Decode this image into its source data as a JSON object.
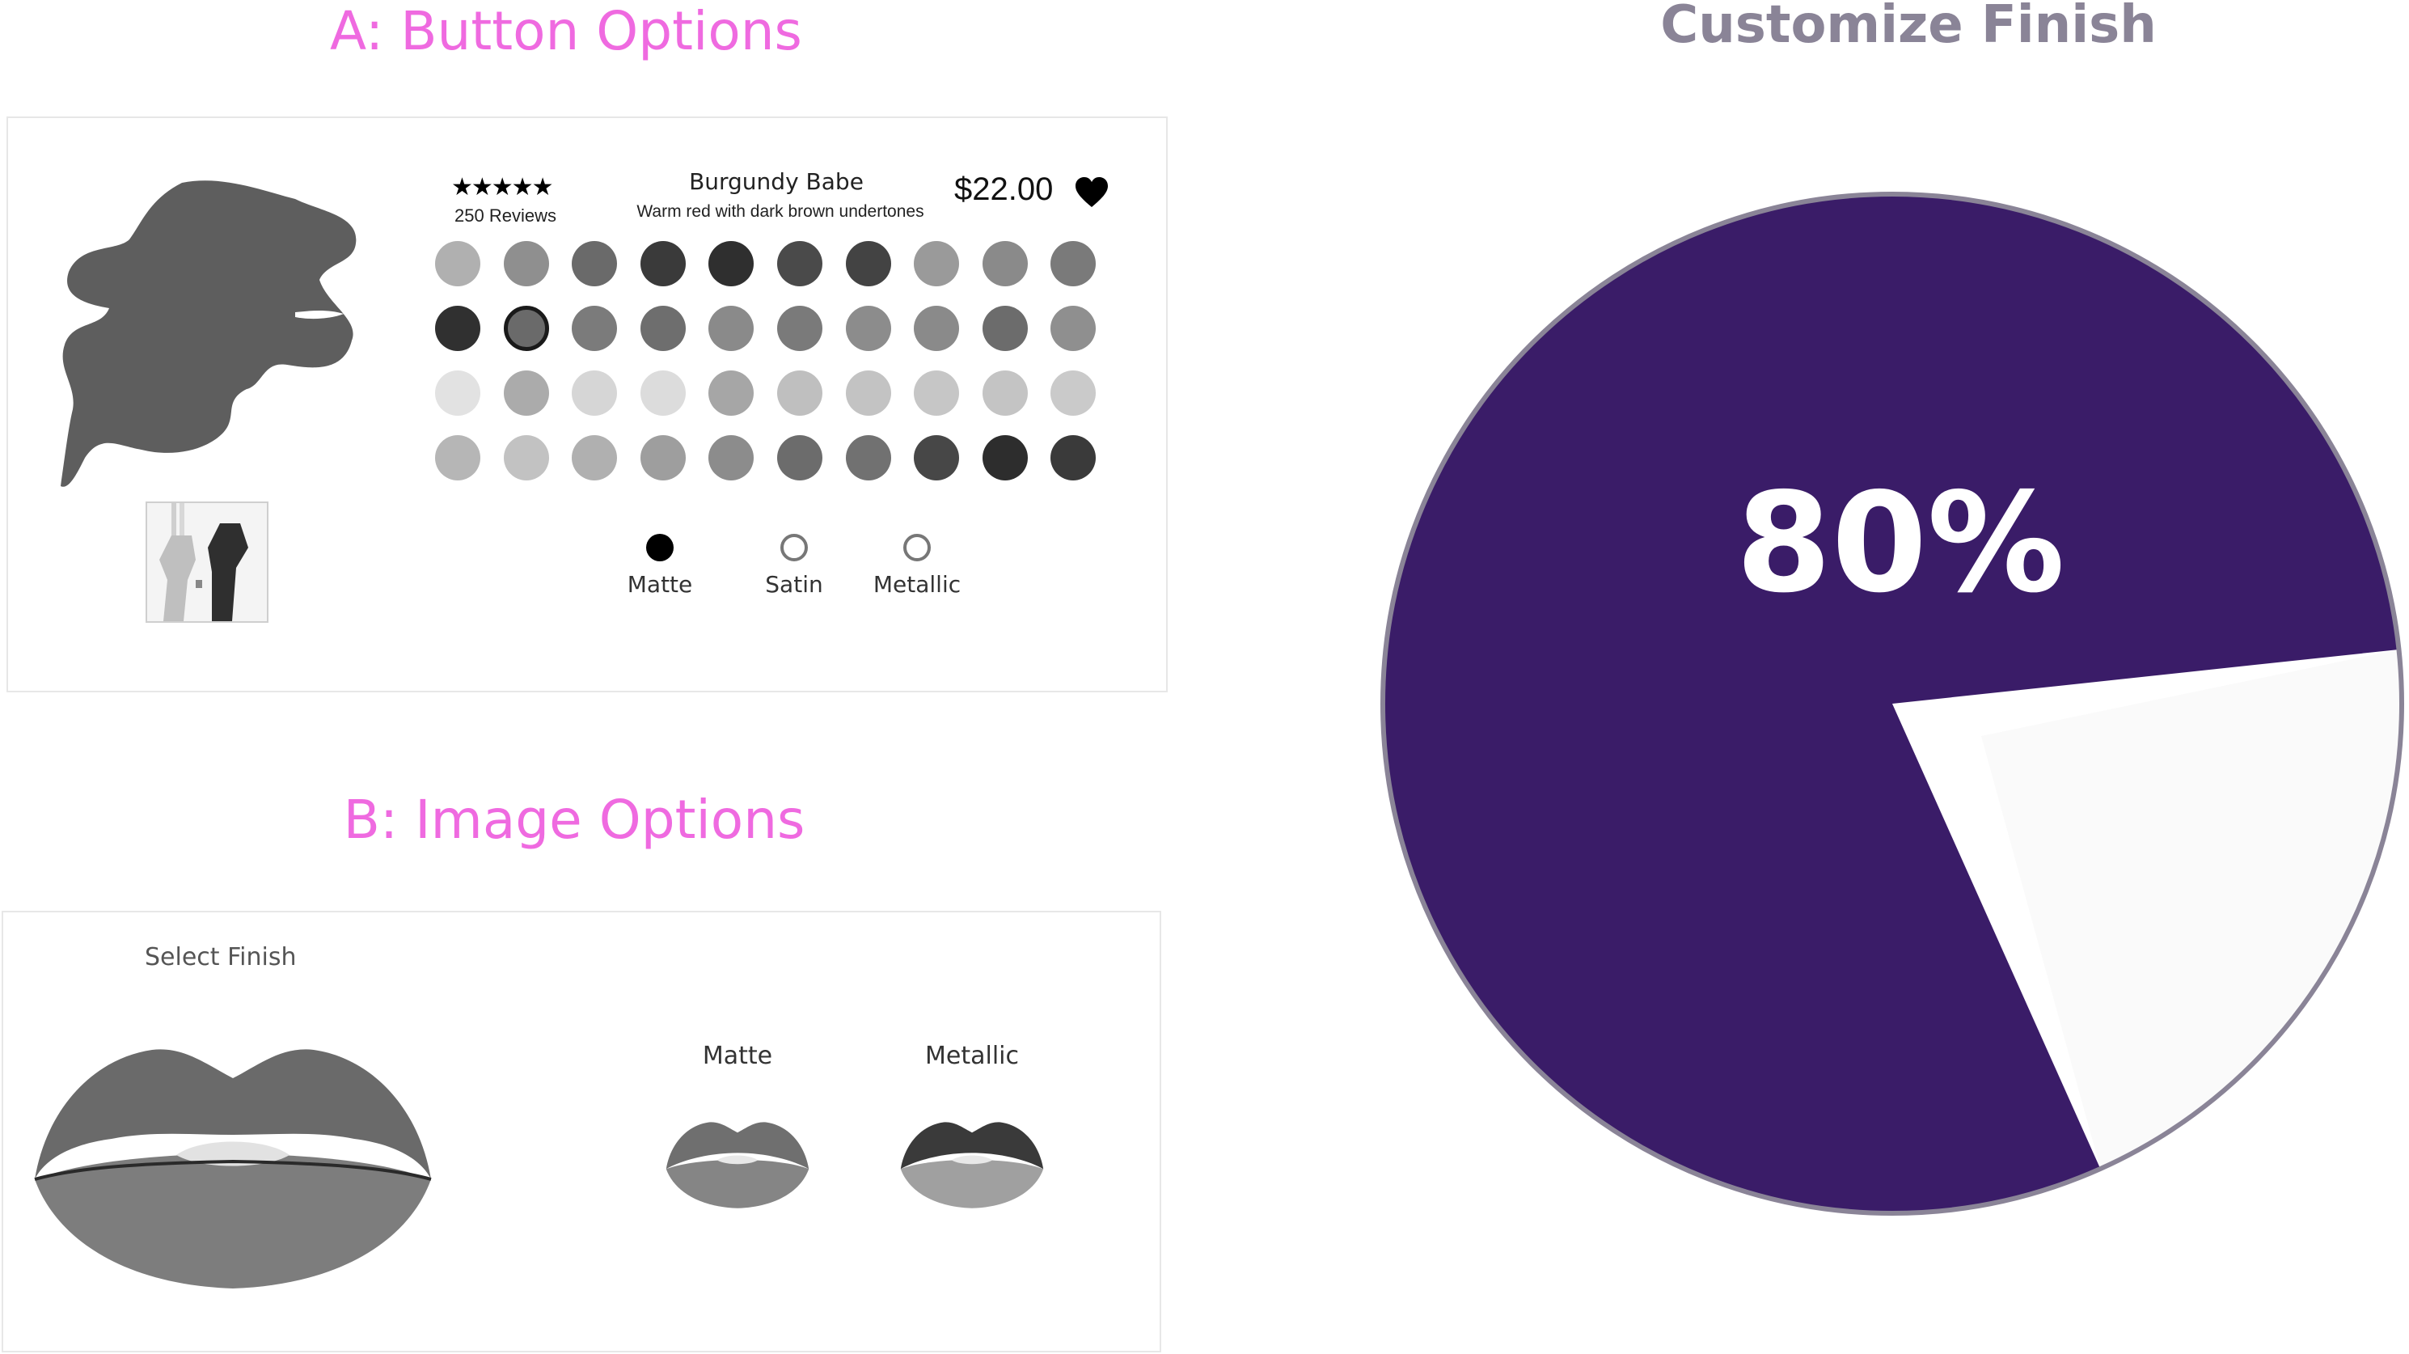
{
  "section_a": {
    "heading": "A: Button Options"
  },
  "section_b": {
    "heading": "B: Image Options"
  },
  "product": {
    "rating_icon": "five-star-rating-icon",
    "reviews": "250 Reviews",
    "name": "Burgundy Babe",
    "description": "Warm red with dark brown undertones",
    "price": "$22.00",
    "favorite_icon": "heart-icon"
  },
  "swatch_rows": [
    [
      "#b0b0b0",
      "#8f8f8f",
      "#6a6a6a",
      "#3a3a3a",
      "#2f2f2f",
      "#4a4a4a",
      "#434343",
      "#9a9a9a",
      "#8a8a8a",
      "#7a7a7a"
    ],
    [
      "#303030",
      "#6a6a6a",
      "#7b7b7b",
      "#6e6e6e",
      "#8a8a8a",
      "#7a7a7a",
      "#8c8c8c",
      "#8a8a8a",
      "#6c6c6c",
      "#8f8f8f"
    ],
    [
      "#e2e2e2",
      "#ababab",
      "#d6d6d6",
      "#dcdcdc",
      "#a6a6a6",
      "#bfbfbf",
      "#c3c3c3",
      "#c6c6c6",
      "#c4c4c4",
      "#cacaca"
    ],
    [
      "#b6b6b6",
      "#c2c2c2",
      "#b0b0b0",
      "#9e9e9e",
      "#8c8c8c",
      "#6c6c6c",
      "#717171",
      "#474747",
      "#2d2d2d",
      "#3a3a3a"
    ]
  ],
  "selected_swatch": {
    "row": 1,
    "col": 1
  },
  "finish_options": [
    {
      "label": "Matte",
      "selected": true
    },
    {
      "label": "Satin",
      "selected": false
    },
    {
      "label": "Metallic",
      "selected": false
    }
  ],
  "image_options": {
    "title": "Select Finish",
    "options": [
      {
        "label": "Matte"
      },
      {
        "label": "Metallic"
      }
    ]
  },
  "chart": {
    "title": "Customize Finish",
    "center_label": "80%"
  },
  "chart_data": {
    "type": "pie",
    "title": "Customize Finish",
    "values": [
      80,
      20
    ],
    "colors": [
      "#3a1c68",
      "#fafafa"
    ],
    "labels": [
      "80%",
      ""
    ]
  }
}
